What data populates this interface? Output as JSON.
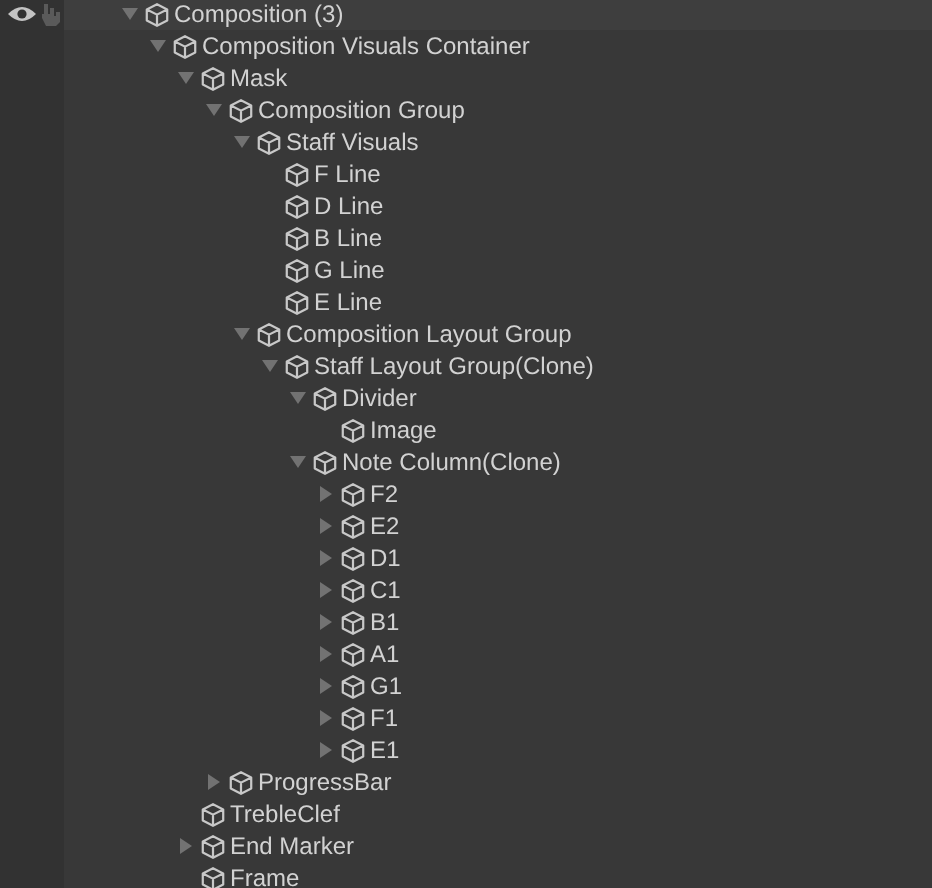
{
  "hierarchy": [
    {
      "label": "Composition (3)",
      "expanded": true,
      "children": [
        {
          "label": "Composition Visuals Container",
          "expanded": true,
          "children": [
            {
              "label": "Mask",
              "expanded": true,
              "children": [
                {
                  "label": "Composition Group",
                  "expanded": true,
                  "children": [
                    {
                      "label": "Staff Visuals",
                      "expanded": true,
                      "children": [
                        {
                          "label": "F Line"
                        },
                        {
                          "label": "D Line"
                        },
                        {
                          "label": "B Line"
                        },
                        {
                          "label": "G Line"
                        },
                        {
                          "label": "E Line"
                        }
                      ]
                    },
                    {
                      "label": "Composition Layout Group",
                      "expanded": true,
                      "children": [
                        {
                          "label": "Staff Layout Group(Clone)",
                          "expanded": true,
                          "children": [
                            {
                              "label": "Divider",
                              "expanded": true,
                              "children": [
                                {
                                  "label": "Image"
                                }
                              ]
                            },
                            {
                              "label": "Note Column(Clone)",
                              "expanded": true,
                              "children": [
                                {
                                  "label": "F2",
                                  "expanded": false
                                },
                                {
                                  "label": "E2",
                                  "expanded": false
                                },
                                {
                                  "label": "D1",
                                  "expanded": false
                                },
                                {
                                  "label": "C1",
                                  "expanded": false
                                },
                                {
                                  "label": "B1",
                                  "expanded": false
                                },
                                {
                                  "label": "A1",
                                  "expanded": false
                                },
                                {
                                  "label": "G1",
                                  "expanded": false
                                },
                                {
                                  "label": "F1",
                                  "expanded": false
                                },
                                {
                                  "label": "E1",
                                  "expanded": false
                                }
                              ]
                            }
                          ]
                        }
                      ]
                    }
                  ]
                },
                {
                  "label": "ProgressBar",
                  "expanded": false
                }
              ]
            },
            {
              "label": "TrebleClef"
            },
            {
              "label": "End Marker",
              "expanded": false
            },
            {
              "label": "Frame"
            }
          ]
        }
      ]
    }
  ]
}
